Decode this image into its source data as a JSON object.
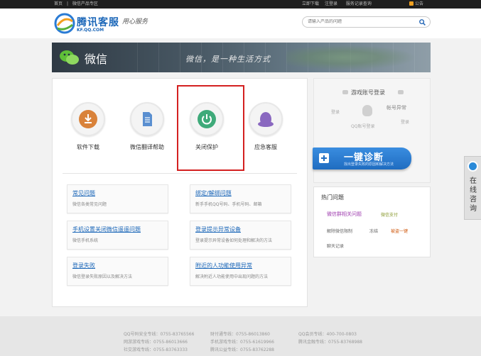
{
  "topbar": {
    "breadcrumb": [
      "首页",
      "|",
      "微信产品专区"
    ],
    "links": [
      "立即下载",
      "注登录",
      "服务记录查询"
    ],
    "notice": "公告"
  },
  "header": {
    "logo_title": "腾讯客服",
    "logo_url": "KF.QQ.COM",
    "slogan": "用心服务",
    "search_placeholder": "请输入产品的问题"
  },
  "banner": {
    "title": "微信",
    "slogan": "微信，是一种生活方式"
  },
  "quick_links": [
    {
      "label": "软件下载",
      "color": "#d9823a",
      "icon": "download-icon"
    },
    {
      "label": "微信翻译帮助",
      "color": "#5a8fd0",
      "icon": "document-icon"
    },
    {
      "label": "关闭保护",
      "color": "#3faa7a",
      "icon": "power-icon"
    },
    {
      "label": "应急客服",
      "color": "#8a68c0",
      "icon": "qq-penguin-icon"
    }
  ],
  "faq": [
    {
      "title": "常见问题",
      "desc": "微信各类常见问题"
    },
    {
      "title": "绑定/解绑问题",
      "desc": "新手手机QQ号码、手机号码、邮箱"
    },
    {
      "title": "手机设置关闭微信遥遥问题",
      "desc": "微信手机系统"
    },
    {
      "title": "登录提示异常设备",
      "desc": "登录提示异常设备如何处理和解决的方法"
    },
    {
      "title": "登录失败",
      "desc": "微信登录失败原因以及解决方法"
    },
    {
      "title": "附近的人功能使用异常",
      "desc": "解决附近人功能使用中出现问题的方法"
    }
  ],
  "login_panel": {
    "title": "游戏账号登录",
    "left": "登录",
    "right": "帐号异常",
    "bottom_left": "QQ账号登录",
    "bottom_right": "登录"
  },
  "diagnose": {
    "title": "一键诊断",
    "subtitle": "找出登录失败的原因和解决方法"
  },
  "hot": {
    "title": "热门问题",
    "items": [
      {
        "text": "微信群相关问题",
        "color": "#a040b0"
      },
      {
        "text": "微信支付",
        "color": "#8a9a30"
      },
      {
        "text": "解除微信限制",
        "color": "#666666"
      },
      {
        "text": "冻结",
        "color": "#666666"
      },
      {
        "text": "被盗一键",
        "color": "#d05a10"
      },
      {
        "text": "聊天记录",
        "color": "#666666"
      }
    ]
  },
  "float_widget": {
    "label": "在线咨询"
  },
  "footer": {
    "rows": [
      [
        "QQ号码安全专线：0755-83765566",
        "财付通专线：0755-86013860",
        "QQ会员专线：400-700-0803"
      ],
      [
        "网游游戏专线：0755-86013666",
        "手机游戏专线：0755-61619966",
        "腾讯金融专线：0755-83768988"
      ],
      [
        "社交游戏专线：0755-83763333",
        "腾讯公益专线：0755-83762288",
        ""
      ]
    ]
  }
}
